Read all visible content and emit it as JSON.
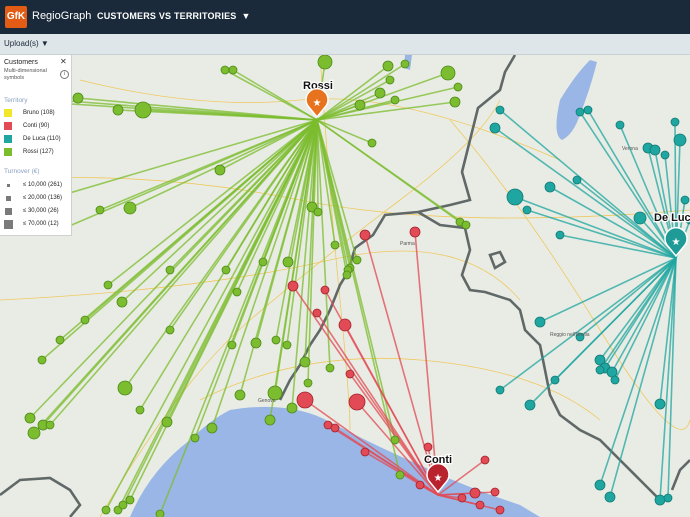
{
  "app": {
    "logo_text": "GfK",
    "name": "RegioGraph",
    "map_menu": "CUSTOMERS VS TERRITORIES"
  },
  "toolbar": {
    "uploads_label": "Upload(s)"
  },
  "legend": {
    "title": "Customers",
    "subtitle": "Multi-dimensional symbols",
    "territory_heading": "Territory",
    "territories": [
      {
        "label": "Bruno (108)",
        "color": "#f0e62a"
      },
      {
        "label": "Conti (90)",
        "color": "#e24a55"
      },
      {
        "label": "De Luca (110)",
        "color": "#1fa6a1"
      },
      {
        "label": "Rossi (127)",
        "color": "#7cbd2f"
      }
    ],
    "turnover_heading": "Turnover (€)",
    "turnover": [
      {
        "label": "≤ 10,000 (261)"
      },
      {
        "label": "≤ 20,000 (136)"
      },
      {
        "label": "≤ 30,000 (26)"
      },
      {
        "label": "≤ 70,000 (12)"
      }
    ]
  },
  "map": {
    "hubs": [
      {
        "name": "Rossi",
        "color": "#e8731e"
      },
      {
        "name": "De Luca",
        "color": "#1e9b97"
      },
      {
        "name": "Conti",
        "color": "#b8232e"
      }
    ],
    "places": [
      "Parma",
      "Genova",
      "Reggio nell'Emilia",
      "Verona"
    ]
  },
  "colors": {
    "rossi": "#7cbd2f",
    "conti": "#e24a55",
    "deluca": "#1fa6a1",
    "sea": "#9ab6e6",
    "land": "#e9ece4"
  }
}
